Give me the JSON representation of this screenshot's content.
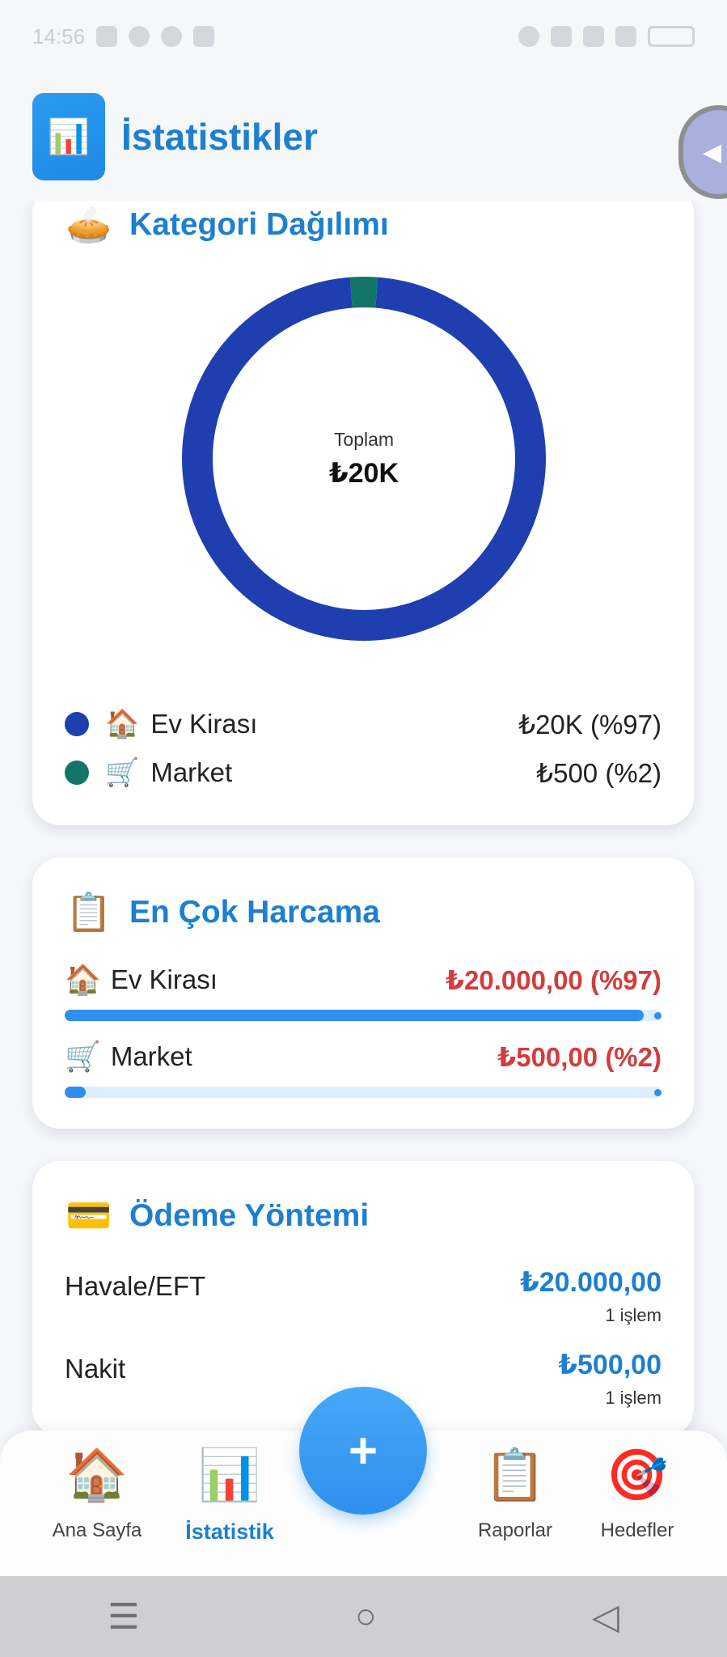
{
  "status": {
    "time": "14:56"
  },
  "appbar": {
    "title": "İstatistikler",
    "logo_icon": "chart-icon"
  },
  "category_card": {
    "emoji": "🥧",
    "title": "Kategori Dağılımı",
    "center_label": "Toplam",
    "center_value": "₺20K",
    "legend": [
      {
        "emoji": "🏠",
        "name": "Ev Kirası",
        "value": "₺20K (%97)",
        "color": "#1f3fb0"
      },
      {
        "emoji": "🛒",
        "name": "Market",
        "value": "₺500 (%2)",
        "color": "#127567"
      }
    ]
  },
  "chart_data": {
    "type": "pie",
    "categories": [
      "Ev Kirası",
      "Market"
    ],
    "values": [
      20000,
      500
    ],
    "colors": [
      "#1f3fb0",
      "#127567"
    ]
  },
  "top_spending": {
    "emoji": "📋",
    "title": "En Çok Harcama",
    "items": [
      {
        "emoji": "🏠",
        "name": "Ev Kirası",
        "amount": "₺20.000,00 (%97)",
        "fraction": 0.97
      },
      {
        "emoji": "🛒",
        "name": "Market",
        "amount": "₺500,00 (%2)",
        "fraction": 0.02
      }
    ]
  },
  "payment": {
    "emoji": "💳",
    "title": "Ödeme Yöntemi",
    "rows": [
      {
        "name": "Havale/EFT",
        "amount": "₺20.000,00",
        "count": "1 işlem"
      },
      {
        "name": "Nakit",
        "amount": "₺500,00",
        "count": "1 işlem"
      }
    ]
  },
  "nav": {
    "items": [
      {
        "icon": "🏠",
        "label": "Ana Sayfa"
      },
      {
        "icon": "📊",
        "label": "İstatistik"
      },
      {
        "icon": "📋",
        "label": "Raporlar"
      },
      {
        "icon": "🎯",
        "label": "Hedefler"
      }
    ],
    "fab": "+"
  },
  "colors": {
    "accent": "#1e7fd0",
    "expense": "#d23d3d",
    "bar": "#2f8ef0"
  }
}
